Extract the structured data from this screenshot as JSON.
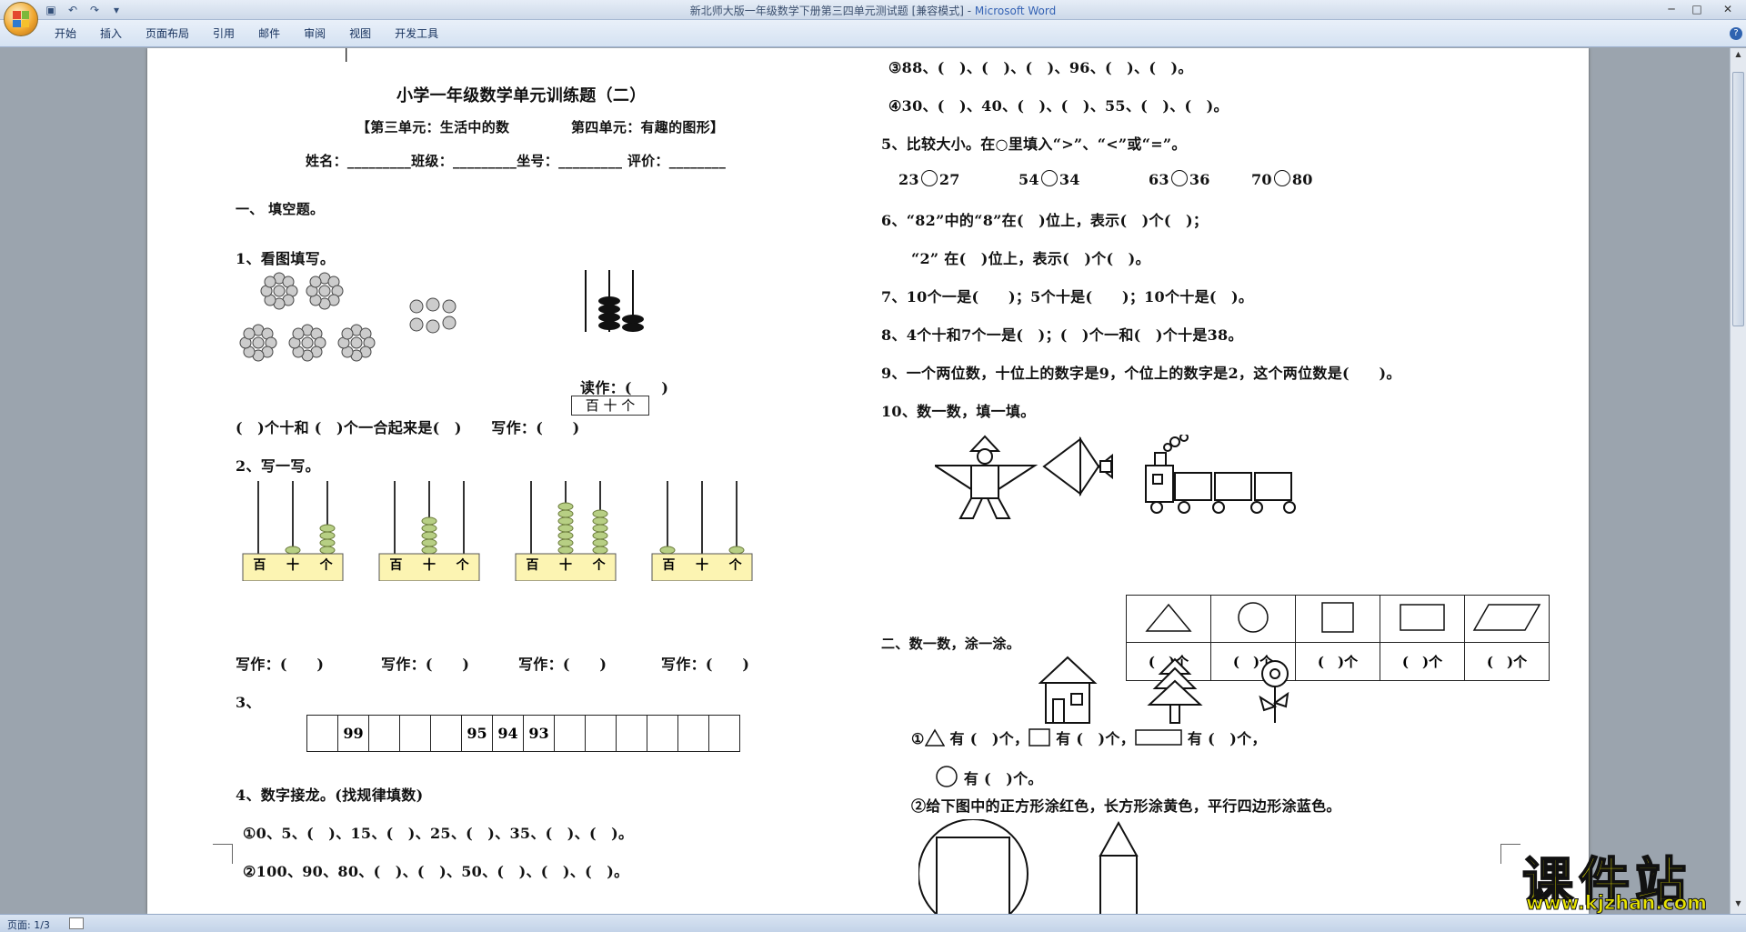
{
  "window": {
    "title": "新北师大版一年级数学下册第三四单元测试题 [兼容模式] - ",
    "app": "Microsoft Word"
  },
  "ribbon": {
    "tabs": [
      "开始",
      "插入",
      "页面布局",
      "引用",
      "邮件",
      "审阅",
      "视图",
      "开发工具"
    ]
  },
  "status": {
    "page": "页面: 1/3"
  },
  "watermark": {
    "brand": "课件站",
    "url": "www.kjzhan.com"
  },
  "doc": {
    "title": "小学一年级数学单元训练题（二）",
    "subtitle_a": "【第三单元：生活中的数",
    "subtitle_b": "第四单元：有趣的图形】",
    "info_line": "姓名：_________班级：_________坐号：_________ 评价：________",
    "sec1": "一、 填空题。",
    "q1": "1、看图填写。",
    "abacus_labels": "百 十 个",
    "q1_read": "读作：(　　)",
    "q1_line": "(　)个十和 (　)个一合起来是(　)　　写作：(　　)",
    "q2": "2、写一写。",
    "q2_write": [
      "写作：(　　)",
      "写作：(　　)",
      "写作：(　　)",
      "写作：(　　)"
    ],
    "abacus_cells": [
      "百",
      "十",
      "个"
    ],
    "q3": "3、",
    "q3_cells": [
      "",
      "99",
      "",
      "",
      "",
      "95",
      "94",
      "93",
      "",
      "",
      "",
      "",
      "",
      ""
    ],
    "q4": "4、数字接龙。(找规律填数)",
    "q4_1": "①0、5、(　)、15、(　)、25、(　)、35、(　)、(　)。",
    "q4_2": "②100、90、80、(　)、(　)、50、(　)、(　)、(　)。",
    "q4_3": "③88、(　)、(　)、(　)、96、(　)、(　)。",
    "q4_4": "④30、(　)、40、(　)、(　)、55、(　)、(　)。",
    "q5": "5、比较大小。在○里填入“>”、“<”或“=”。",
    "q5_pairs": [
      [
        "23",
        "27"
      ],
      [
        "54",
        "34"
      ],
      [
        "63",
        "36"
      ],
      [
        "70",
        "80"
      ]
    ],
    "q6a": "6、“82”中的“8”在(　)位上，表示(　)个(　)；",
    "q6b": "“2” 在(　)位上，表示(　)个(　)。",
    "q7": "7、10个一是(　　)；5个十是(　　)；10个十是(　)。",
    "q8": "8、4个十和7个一是(　)；(　)个一和(　)个十是38。",
    "q9": "9、一个两位数，十位上的数字是9，个位上的数字是2，这个两位数是(　　)。",
    "q10": "10、数一数，填一填。",
    "q10_counts": [
      "(　)个",
      "(　)个",
      "(　)个",
      "(　)个",
      "(　)个"
    ],
    "sec2": "二、数一数，涂一涂。",
    "s2_1a": "①",
    "s2_1b": "有 (　)个，",
    "s2_1c": "有 (　)个，",
    "s2_1d": "有 (　)个，",
    "s2_1e": "有 (　)个。",
    "s2_2": "②给下图中的正方形涂红色，长方形涂黄色，平行四边形涂蓝色。"
  }
}
